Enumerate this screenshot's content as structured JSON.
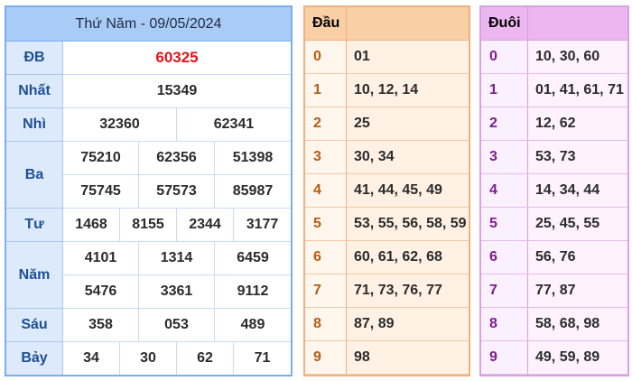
{
  "results": {
    "title": "Thứ Năm - 09/05/2024",
    "special": {
      "label": "ĐB",
      "value": "60325"
    },
    "first": {
      "label": "Nhất",
      "value": "15349"
    },
    "second": {
      "label": "Nhì",
      "values": [
        "32360",
        "62341"
      ]
    },
    "third": {
      "label": "Ba",
      "values": [
        "75210",
        "62356",
        "51398",
        "75745",
        "57573",
        "85987"
      ]
    },
    "fourth": {
      "label": "Tư",
      "values": [
        "1468",
        "8155",
        "2344",
        "3177"
      ]
    },
    "fifth": {
      "label": "Năm",
      "values": [
        "4101",
        "1314",
        "6459",
        "5476",
        "3361",
        "9112"
      ]
    },
    "sixth": {
      "label": "Sáu",
      "values": [
        "358",
        "053",
        "489"
      ]
    },
    "seventh": {
      "label": "Bảy",
      "values": [
        "34",
        "30",
        "62",
        "71"
      ]
    }
  },
  "dau": {
    "header": "Đầu",
    "rows": [
      {
        "key": "0",
        "value": "01"
      },
      {
        "key": "1",
        "value": "10, 12, 14"
      },
      {
        "key": "2",
        "value": "25"
      },
      {
        "key": "3",
        "value": "30, 34"
      },
      {
        "key": "4",
        "value": "41, 44, 45, 49"
      },
      {
        "key": "5",
        "value": "53, 55, 56, 58, 59"
      },
      {
        "key": "6",
        "value": "60, 61, 62, 68"
      },
      {
        "key": "7",
        "value": "71, 73, 76, 77"
      },
      {
        "key": "8",
        "value": "87, 89"
      },
      {
        "key": "9",
        "value": "98"
      }
    ]
  },
  "duoi": {
    "header": "Đuôi",
    "rows": [
      {
        "key": "0",
        "value": "10, 30, 60"
      },
      {
        "key": "1",
        "value": "01, 41, 61, 71"
      },
      {
        "key": "2",
        "value": "12, 62"
      },
      {
        "key": "3",
        "value": "53, 73"
      },
      {
        "key": "4",
        "value": "14, 34, 44"
      },
      {
        "key": "5",
        "value": "25, 45, 55"
      },
      {
        "key": "6",
        "value": "56, 76"
      },
      {
        "key": "7",
        "value": "77, 87"
      },
      {
        "key": "8",
        "value": "58, 68, 98"
      },
      {
        "key": "9",
        "value": "49, 59, 89"
      }
    ]
  }
}
